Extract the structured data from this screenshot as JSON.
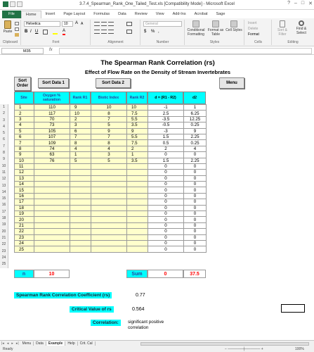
{
  "window": {
    "title": "3.7.4_Spearman_Rank_One_Tailed_Test.xls [Compatibility Mode] - Microsoft Excel",
    "controls": [
      "?",
      "–",
      "□",
      "✕"
    ]
  },
  "ribbon_tabs": [
    "File",
    "Home",
    "Insert",
    "Page Layout",
    "Formulas",
    "Data",
    "Review",
    "View",
    "Add-Ins",
    "Acrobat",
    "Sage"
  ],
  "ribbon": {
    "clipboard": {
      "label": "Clipboard",
      "paste": "Paste"
    },
    "font": {
      "label": "Font",
      "name": "Helvetica",
      "size": "10"
    },
    "alignment": {
      "label": "Alignment"
    },
    "number": {
      "label": "Number",
      "format": "General"
    },
    "styles": {
      "label": "Styles",
      "conditional": "Conditional Formatting",
      "format_table": "Format as Table",
      "cell_styles": "Cell Styles"
    },
    "cells": {
      "label": "Cells",
      "insert": "Insert",
      "delete": "Delete",
      "format": "Format"
    },
    "editing": {
      "label": "Editing",
      "sort": "Sort & Filter",
      "find": "Find & Select"
    }
  },
  "formula_bar": {
    "name_box": "M35",
    "fx": "fx",
    "value": ""
  },
  "sheet": {
    "title": "The Spearman Rank Correlation (rs)",
    "subtitle": "Effect of Flow Rate on the Density of Stream Invertebrates",
    "buttons": {
      "sort_order": "Sort Order",
      "sort1": "Sort Data 1",
      "sort2": "Sort Data 2",
      "menu": "Menu"
    },
    "headers": {
      "site": "Site",
      "oxygen": "Oxygen % saturation",
      "rank1": "Rank R1",
      "biotic": "Biotic Index",
      "rank2": "Rank R2",
      "d": "d = (R1 - R2)",
      "d2": "d2"
    },
    "rows": [
      [
        "1",
        "110",
        "9",
        "10",
        "10",
        "-1",
        "1"
      ],
      [
        "2",
        "117",
        "10",
        "8",
        "7.5",
        "2.5",
        "6.25"
      ],
      [
        "3",
        "70",
        "2",
        "7",
        "5.5",
        "-3.5",
        "12.25"
      ],
      [
        "4",
        "73",
        "3",
        "5",
        "3.5",
        "-0.5",
        "0.25"
      ],
      [
        "5",
        "105",
        "6",
        "9",
        "9",
        "-3",
        "9"
      ],
      [
        "6",
        "107",
        "7",
        "7",
        "5.5",
        "1.5",
        "2.25"
      ],
      [
        "7",
        "109",
        "8",
        "8",
        "7.5",
        "0.5",
        "0.25"
      ],
      [
        "8",
        "74",
        "4",
        "4",
        "2",
        "2",
        "4"
      ],
      [
        "9",
        "63",
        "1",
        "3",
        "1",
        "0",
        "0"
      ],
      [
        "10",
        "76",
        "5",
        "5",
        "3.5",
        "1.5",
        "2.25"
      ],
      [
        "11",
        "",
        "",
        "",
        "",
        "0",
        "0"
      ],
      [
        "12",
        "",
        "",
        "",
        "",
        "0",
        "0"
      ],
      [
        "13",
        "",
        "",
        "",
        "",
        "0",
        "0"
      ],
      [
        "14",
        "",
        "",
        "",
        "",
        "0",
        "0"
      ],
      [
        "15",
        "",
        "",
        "",
        "",
        "0",
        "0"
      ],
      [
        "16",
        "",
        "",
        "",
        "",
        "0",
        "0"
      ],
      [
        "17",
        "",
        "",
        "",
        "",
        "0",
        "0"
      ],
      [
        "18",
        "",
        "",
        "",
        "",
        "0",
        "0"
      ],
      [
        "19",
        "",
        "",
        "",
        "",
        "0",
        "0"
      ],
      [
        "20",
        "",
        "",
        "",
        "",
        "0",
        "0"
      ],
      [
        "21",
        "",
        "",
        "",
        "",
        "0",
        "0"
      ],
      [
        "22",
        "",
        "",
        "",
        "",
        "0",
        "0"
      ],
      [
        "23",
        "",
        "",
        "",
        "",
        "0",
        "0"
      ],
      [
        "24",
        "",
        "",
        "",
        "",
        "0",
        "0"
      ],
      [
        "25",
        "",
        "",
        "",
        "",
        "0",
        "0"
      ]
    ],
    "totals": {
      "n_label": "n",
      "n_value": "10",
      "sum_label": "Sum",
      "sum_d": "0",
      "sum_d2": "37.5"
    },
    "results": {
      "coef_label": "Spearman Rank Correlation Coefficient (rs)",
      "coef_value": "0.77",
      "crit_label": "Critical Value of rs",
      "crit_value": "0.564",
      "corr_label": "Correlation:",
      "corr_value": "significant positive correlation"
    }
  },
  "sheet_tabs": [
    "Menu",
    "Data",
    "Example",
    "Help",
    "Crit. Cal"
  ],
  "active_sheet_tab": "Example",
  "status": {
    "ready": "Ready",
    "zoom": "100%"
  },
  "colors": {
    "header_cyan": "#00ffff",
    "input_yellow": "#ffffcc",
    "value_red": "#ff0000",
    "excel_green": "#217346"
  }
}
